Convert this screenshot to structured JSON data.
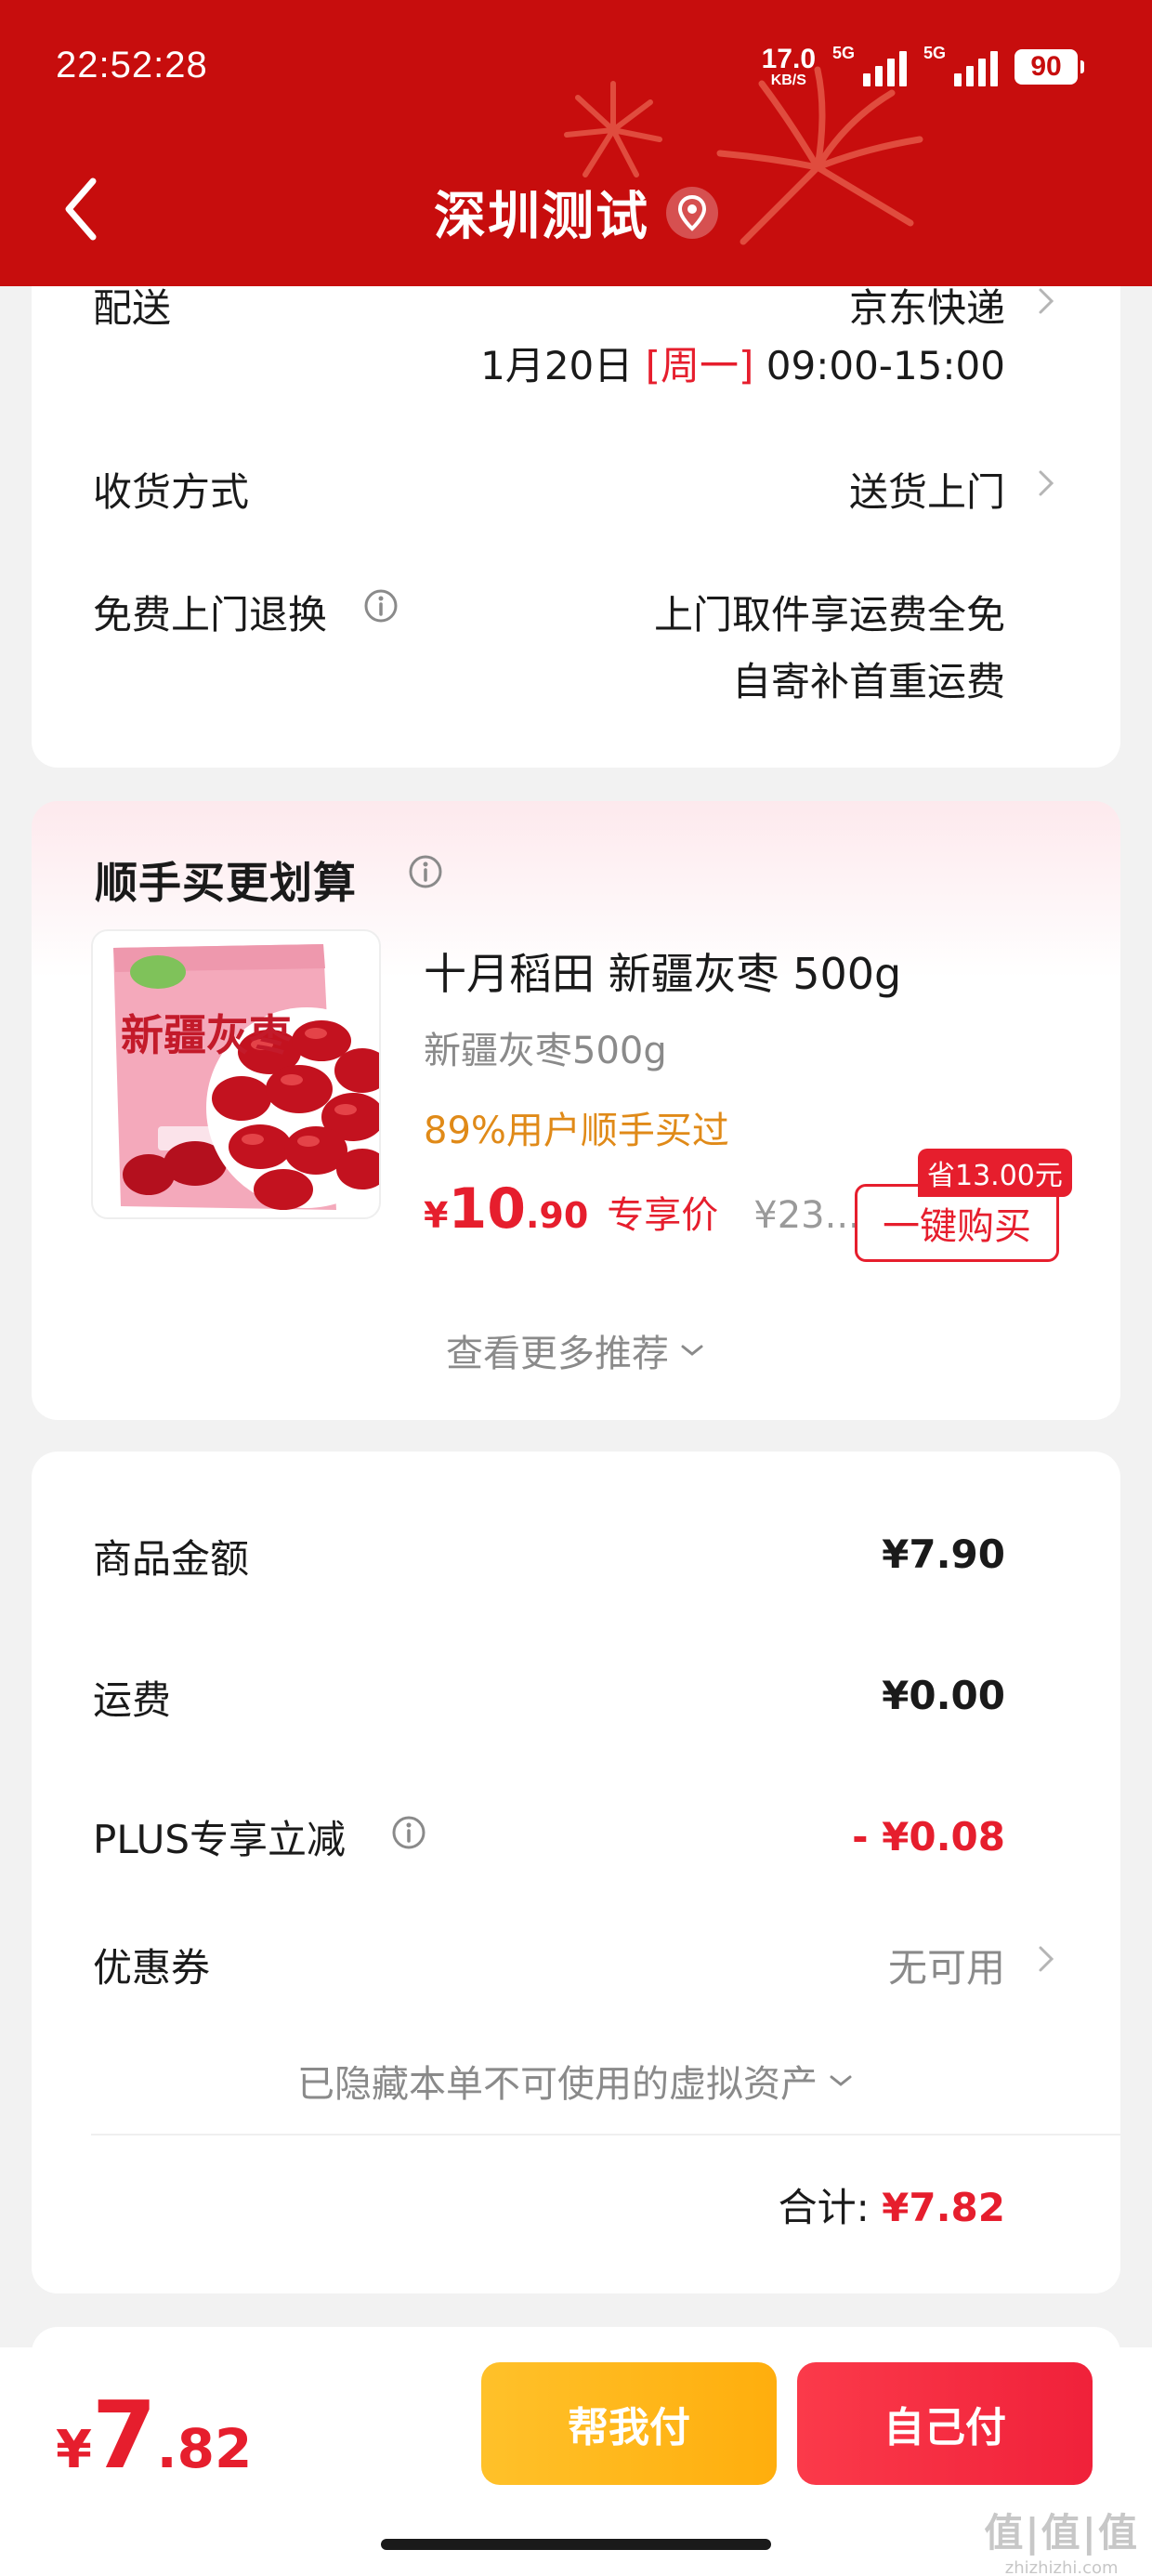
{
  "status_bar": {
    "time": "22:52:28",
    "net_speed": "17.0",
    "net_unit": "KB/S",
    "sim1": "5G",
    "sim2": "5G",
    "battery": "90"
  },
  "nav": {
    "title": "深圳测试",
    "back_icon": "chevron-left-icon",
    "location_icon": "location-pin-icon"
  },
  "delivery": {
    "label": "配送",
    "carrier": "京东快递",
    "date": "1月20日",
    "weekday": "[周一]",
    "time_window": "09:00-15:00",
    "receive_label": "收货方式",
    "receive_value": "送货上门",
    "return_label": "免费上门退换",
    "return_line1": "上门取件享运费全免",
    "return_line2": "自寄补首重运费"
  },
  "recommend": {
    "title": "顺手买更划算",
    "product_name": "十月稻田 新疆灰枣  500g",
    "spec": "新疆灰枣500g",
    "buy_rate": "89%用户顺手买过",
    "price_yen": "¥",
    "price_int": "10",
    "price_dec": ".90",
    "price_tag": "专享价",
    "original_price": "¥23....",
    "save_badge": "省13.00元",
    "buy_button": "一键购买",
    "more_label": "查看更多推荐",
    "package_text": "新疆灰枣"
  },
  "summary": {
    "goods_label": "商品金额",
    "goods_value": "¥7.90",
    "shipping_label": "运费",
    "shipping_value": "¥0.00",
    "plus_label": "PLUS专享立减",
    "plus_value": "- ¥0.08",
    "coupon_label": "优惠券",
    "coupon_value": "无可用",
    "hidden_assets": "已隐藏本单不可使用的虚拟资产",
    "total_label": "合计:",
    "total_value": "¥7.82"
  },
  "bottom_bar": {
    "yen": "¥",
    "price_int": "7",
    "price_dec": ".82",
    "help_pay": "帮我付",
    "self_pay": "自己付"
  },
  "watermark": {
    "line1": "值|值|值",
    "line2": "zhizhizhi.com"
  },
  "colors": {
    "header_red": "#c70d0d",
    "accent_red": "#e61e2d",
    "orange": "#e08a18",
    "yellow_button": "#ffb81c",
    "red_button": "#f42b41"
  }
}
